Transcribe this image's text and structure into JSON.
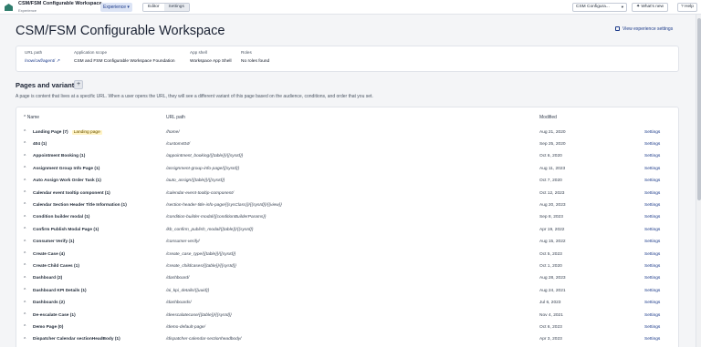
{
  "topbar": {
    "app_title": "CSM/FSM Configurable Workspace",
    "app_subtitle": "Experience",
    "experience_button": "Experience ▾",
    "editor_tab": "Editor",
    "settings_tab": "Settings",
    "workspace_select": "CSM Configura...",
    "whats_new": "What's new",
    "help": "Help"
  },
  "page_title": "CSM/FSM Configurable Workspace",
  "view_settings_link": "View experience settings",
  "info": {
    "url_path_label": "URL path",
    "url_path_value": "/now/cwf/agent/",
    "app_scope_label": "Application scope",
    "app_scope_value": "CSM and FSM Configurable Workspace Foundation",
    "app_shell_label": "App shell",
    "app_shell_value": "Workspace App Shell",
    "roles_label": "Roles",
    "roles_value": "No roles found"
  },
  "pages": {
    "title": "Pages and variants",
    "add_label": "+",
    "description": "A page is content that lives at a specific URL. When a user opens the URL, they will see a different variant of this page based on the audience, conditions, and order that you set.",
    "headers": {
      "name": "Name",
      "url_path": "URL path",
      "modified": "Modified"
    },
    "rows": [
      {
        "name": "Landing Page (7)",
        "badge": "Landing page",
        "path": "/home/",
        "modified": "Aug 21, 2020",
        "action": "Settings"
      },
      {
        "name": "404 (1)",
        "badge": "",
        "path": "/custom404/",
        "modified": "Sep 25, 2020",
        "action": "Settings"
      },
      {
        "name": "Appointment Booking (1)",
        "badge": "",
        "path": "/appointment_booking/{{table}}/{{sysId}}",
        "modified": "Oct 6, 2020",
        "action": "Settings"
      },
      {
        "name": "Assignment Group Info Page (1)",
        "badge": "",
        "path": "/assignment-group-info-page/{{sysId}}",
        "modified": "Aug 11, 2023",
        "action": "Settings"
      },
      {
        "name": "Auto Assign Work Order Task (1)",
        "badge": "",
        "path": "/auto_assign/{{table}}/{{sysId}}",
        "modified": "Oct 7, 2020",
        "action": "Settings"
      },
      {
        "name": "Calendar event tooltip component (1)",
        "badge": "",
        "path": "/calendar-event-tooltip-component/",
        "modified": "Oct 12, 2023",
        "action": "Settings"
      },
      {
        "name": "Calendar Section Header Title Information (1)",
        "badge": "",
        "path": "/section-header-title-info-page/{{sysClass}}/{{sysId}}/{{view}}",
        "modified": "Aug 20, 2023",
        "action": "Settings"
      },
      {
        "name": "Condition builder modal (1)",
        "badge": "",
        "path": "/condition-builder-modal/{{conditionBuilderParams}}",
        "modified": "Sep 8, 2023",
        "action": "Settings"
      },
      {
        "name": "Confirm Publish Modal Page (1)",
        "badge": "",
        "path": "/kb_confirm_publish_modal/{{table}}/{{sysId}}",
        "modified": "Apr 19, 2022",
        "action": "Settings"
      },
      {
        "name": "Consumer Verify (1)",
        "badge": "",
        "path": "/consumer-verify/",
        "modified": "Aug 15, 2022",
        "action": "Settings"
      },
      {
        "name": "Create Case (4)",
        "badge": "",
        "path": "/create_case_type/{{table}}/{{sysId}}",
        "modified": "Oct 5, 2023",
        "action": "Settings"
      },
      {
        "name": "Create Child Cases (1)",
        "badge": "",
        "path": "/create_childcases/{{table}}/{{sysId}}",
        "modified": "Oct 1, 2020",
        "action": "Settings"
      },
      {
        "name": "Dashboard (2)",
        "badge": "",
        "path": "/dashboard/",
        "modified": "Aug 28, 2023",
        "action": "Settings"
      },
      {
        "name": "Dashboard KPI Details (1)",
        "badge": "",
        "path": "/ai_kpi_details/{{uuid}}",
        "modified": "Aug 24, 2021",
        "action": "Settings"
      },
      {
        "name": "Dashboards (2)",
        "badge": "",
        "path": "/dashboards/",
        "modified": "Jul 6, 2023",
        "action": "Settings"
      },
      {
        "name": "De-escalate Case (1)",
        "badge": "",
        "path": "/deescalatecase/{{table}}/{{sysId}}",
        "modified": "Nov 4, 2021",
        "action": "Settings"
      },
      {
        "name": "Demo Page (0)",
        "badge": "",
        "path": "/demo-default-page/",
        "modified": "Oct 6, 2023",
        "action": "Settings"
      },
      {
        "name": "Dispatcher Calendar sectionHeadBody (1)",
        "badge": "",
        "path": "/dispatcher-calendar-sectionheadbody/",
        "modified": "Apr 3, 2023",
        "action": "Settings"
      }
    ]
  },
  "colors": {
    "accent": "#1b3a8a",
    "badge_bg": "#fff3c4",
    "page_bg": "#f4f5f7"
  }
}
